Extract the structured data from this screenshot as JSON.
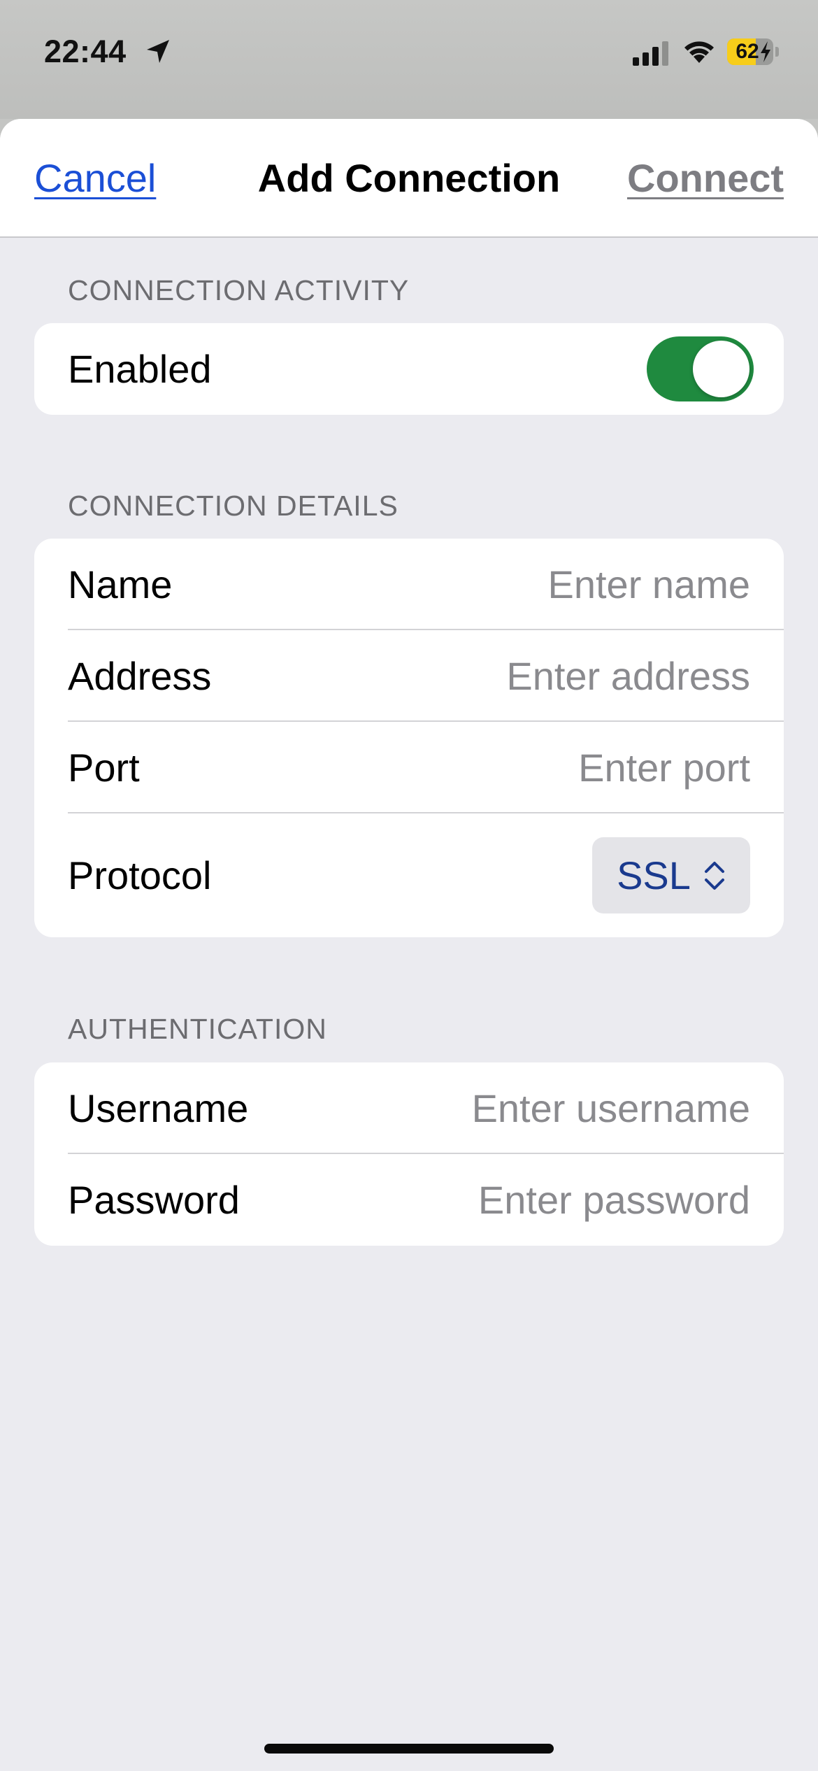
{
  "status_bar": {
    "time": "22:44",
    "battery_percent": "62",
    "battery_level": 0.62,
    "icons": [
      "location-arrow-icon",
      "cellular-signal-icon",
      "wifi-icon",
      "battery-charging-icon"
    ]
  },
  "nav": {
    "cancel_label": "Cancel",
    "title": "Add Connection",
    "connect_label": "Connect"
  },
  "sections": {
    "activity": {
      "header": "CONNECTION ACTIVITY",
      "enabled_label": "Enabled",
      "enabled_on": true
    },
    "details": {
      "header": "CONNECTION DETAILS",
      "name_label": "Name",
      "name_placeholder": "Enter name",
      "address_label": "Address",
      "address_placeholder": "Enter address",
      "port_label": "Port",
      "port_placeholder": "Enter port",
      "protocol_label": "Protocol",
      "protocol_value": "SSL"
    },
    "auth": {
      "header": "AUTHENTICATION",
      "username_label": "Username",
      "username_placeholder": "Enter username",
      "password_label": "Password",
      "password_placeholder": "Enter password"
    }
  },
  "colors": {
    "accent_link": "#1b4fd6",
    "toggle_on": "#1f8a3f",
    "disabled_action": "#7d7d82",
    "battery_charging": "#f7cd1a"
  }
}
